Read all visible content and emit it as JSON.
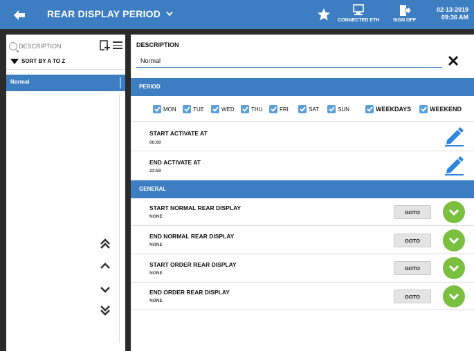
{
  "header": {
    "title": "REAR DISPLAY PERIOD",
    "connected_label": "CONNECTED ETH",
    "signoff_label": "SIGN OFF",
    "date": "02-13-2019",
    "time": "09:36 AM",
    "bg_color": "#3d7ec2"
  },
  "sidebar": {
    "search_placeholder": "DESCRIPTION",
    "sort_label": "SORT BY A TO Z",
    "items": [
      {
        "label": "Normal",
        "selected": true
      }
    ]
  },
  "main": {
    "description_label": "DESCRIPTION",
    "description_value": "Normal",
    "period_header": "PERIOD",
    "days": [
      {
        "label": "MON",
        "checked": true
      },
      {
        "label": "TUE",
        "checked": true
      },
      {
        "label": "WED",
        "checked": true
      },
      {
        "label": "THU",
        "checked": true
      },
      {
        "label": "FRI",
        "checked": true
      },
      {
        "label": "SAT",
        "checked": true
      },
      {
        "label": "SUN",
        "checked": true
      },
      {
        "label": "WEEKDAYS",
        "checked": true
      },
      {
        "label": "WEEKEND",
        "checked": true
      }
    ],
    "start_activate": {
      "title": "START ACTIVATE AT",
      "value": "00:00"
    },
    "end_activate": {
      "title": "END ACTIVATE AT",
      "value": "23:59"
    },
    "general_header": "GENERAL",
    "general_rows": [
      {
        "title": "START NORMAL REAR DISPLAY",
        "value": "NONE",
        "button": "GOTO"
      },
      {
        "title": "END NORMAL REAR DISPLAY",
        "value": "NONE",
        "button": "GOTO"
      },
      {
        "title": "START ORDER REAR DISPLAY",
        "value": "NONE",
        "button": "GOTO"
      },
      {
        "title": "END ORDER REAR DISPLAY",
        "value": "NONE",
        "button": "GOTO"
      }
    ]
  },
  "colors": {
    "accent": "#3d7ec2",
    "checkbox": "#5b9fd9",
    "confirm_green": "#7bbf3f",
    "frame": "#2b2b2b"
  }
}
